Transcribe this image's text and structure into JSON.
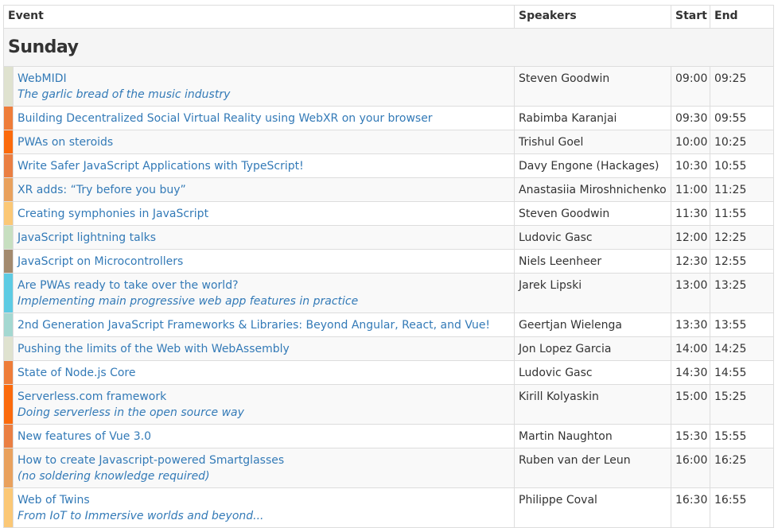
{
  "header": {
    "event": "Event",
    "speakers": "Speakers",
    "start": "Start",
    "end": "End"
  },
  "day": "Sunday",
  "sessions": [
    {
      "title": "WebMIDI",
      "subtitle": "The garlic bread of the music industry",
      "speaker": "Steven Goodwin",
      "start": "09:00",
      "end": "09:25",
      "color": "#dfe2cf"
    },
    {
      "title": "Building Decentralized Social Virtual Reality using WebXR on your browser",
      "subtitle": "",
      "speaker": "Rabimba Karanjai",
      "start": "09:30",
      "end": "09:55",
      "color": "#ee7d3a"
    },
    {
      "title": "PWAs on steroids",
      "subtitle": "",
      "speaker": "Trishul Goel",
      "start": "10:00",
      "end": "10:25",
      "color": "#fb6a0c"
    },
    {
      "title": "Write Safer JavaScript Applications with TypeScript!",
      "subtitle": "",
      "speaker": "Davy Engone (Hackages)",
      "start": "10:30",
      "end": "10:55",
      "color": "#ea7f43"
    },
    {
      "title": "XR adds: “Try before you buy”",
      "subtitle": "",
      "speaker": "Anastasiia Miroshnichenko",
      "start": "11:00",
      "end": "11:25",
      "color": "#e9a15d"
    },
    {
      "title": "Creating symphonies in JavaScript",
      "subtitle": "",
      "speaker": "Steven Goodwin",
      "start": "11:30",
      "end": "11:55",
      "color": "#fbc876"
    },
    {
      "title": "JavaScript lightning talks",
      "subtitle": "",
      "speaker": "Ludovic Gasc",
      "start": "12:00",
      "end": "12:25",
      "color": "#c7dfc0"
    },
    {
      "title": "JavaScript on Microcontrollers",
      "subtitle": "",
      "speaker": "Niels Leenheer",
      "start": "12:30",
      "end": "12:55",
      "color": "#a38a6e"
    },
    {
      "title": "Are PWAs ready to take over the world?",
      "subtitle": "Implementing main progressive web app features in practice",
      "speaker": "Jarek Lipski",
      "start": "13:00",
      "end": "13:25",
      "color": "#5dcbe3"
    },
    {
      "title": "2nd Generation JavaScript Frameworks & Libraries: Beyond Angular, React, and Vue!",
      "subtitle": "",
      "speaker": "Geertjan Wielenga",
      "start": "13:30",
      "end": "13:55",
      "color": "#a4d8d1"
    },
    {
      "title": "Pushing the limits of the Web with WebAssembly",
      "subtitle": "",
      "speaker": "Jon Lopez Garcia",
      "start": "14:00",
      "end": "14:25",
      "color": "#dfe2cf"
    },
    {
      "title": "State of Node.js Core",
      "subtitle": "",
      "speaker": "Ludovic Gasc",
      "start": "14:30",
      "end": "14:55",
      "color": "#ee7d3a"
    },
    {
      "title": "Serverless.com framework",
      "subtitle": "Doing serverless in the open source way",
      "speaker": "Kirill Kolyaskin",
      "start": "15:00",
      "end": "15:25",
      "color": "#fb6a0c"
    },
    {
      "title": "New features of Vue 3.0",
      "subtitle": "",
      "speaker": "Martin Naughton",
      "start": "15:30",
      "end": "15:55",
      "color": "#ea7f43"
    },
    {
      "title": "How to create Javascript-powered Smartglasses",
      "subtitle": "(no soldering knowledge required)",
      "speaker": "Ruben van der Leun",
      "start": "16:00",
      "end": "16:25",
      "color": "#e9a15d"
    },
    {
      "title": "Web of Twins",
      "subtitle": "From IoT to Immersive worlds and beyond...",
      "speaker": "Philippe Coval",
      "start": "16:30",
      "end": "16:55",
      "color": "#fbc876"
    }
  ]
}
